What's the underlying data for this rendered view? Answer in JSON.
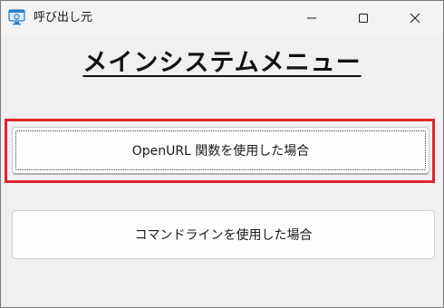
{
  "window": {
    "title": "呼び出し元",
    "icon": "app-window-icon"
  },
  "caption_buttons": {
    "minimize_icon": "minimize-icon",
    "maximize_icon": "maximize-icon",
    "close_icon": "close-icon"
  },
  "main": {
    "heading": "メインシステムメニュー",
    "buttons": [
      {
        "label": "OpenURL 関数を使用した場合",
        "focused": true
      },
      {
        "label": "コマンドラインを使用した場合",
        "focused": false
      }
    ]
  },
  "colors": {
    "focus_highlight": "#e0252f",
    "background": "#f0f0f0"
  }
}
